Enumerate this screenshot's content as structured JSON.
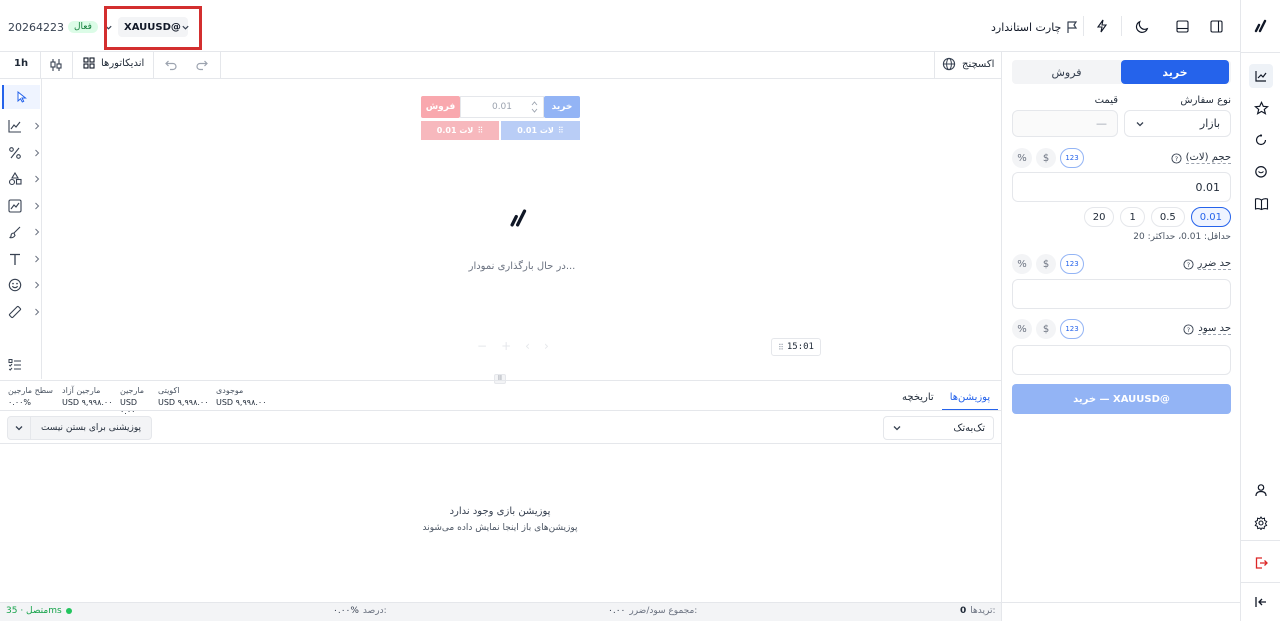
{
  "header": {
    "account_id": "20264223",
    "account_status": "فعال",
    "symbol": "XAUUSD@",
    "chart_type": "چارت استاندارد"
  },
  "chart_toolbar": {
    "exchange": "اکسچنج",
    "indicators": "اندیکاتورها",
    "timeframe": "1h"
  },
  "chart": {
    "loading_text": "در حال بارگذاری نمودار...",
    "time_label": "15:01",
    "trade_widget": {
      "buy_label": "خرید",
      "sell_label": "فروش",
      "lot_value": "0.01",
      "buy_lot_line": "لات 0.01",
      "sell_lot_line": "لات 0.01"
    }
  },
  "order_panel": {
    "buy_tab": "خرید",
    "sell_tab": "فروش",
    "order_type_label": "نوع سفارش",
    "order_type_value": "بازار",
    "price_label": "قیمت",
    "price_placeholder": "—",
    "volume_label": "حجم (لات)",
    "volume_value": "0.01",
    "quick_lots": [
      "0.01",
      "0.5",
      "1",
      "20"
    ],
    "limits_text": "حداقل: 0.01، حداکثر: 20",
    "stop_loss_label": "حد ضرر",
    "take_profit_label": "حد سود",
    "mode_chips": [
      "123",
      "$",
      "%"
    ],
    "submit_label": "خرید — XAUUSD@"
  },
  "bottom_panel": {
    "tabs": [
      "پوزیشن‌ها",
      "تاریخچه"
    ],
    "stats": [
      {
        "label": "موجودی",
        "value": "USD ۹,۹۹۸.۰۰"
      },
      {
        "label": "اکویتی",
        "value": "USD ۹,۹۹۸.۰۰"
      },
      {
        "label": "مارجین",
        "value": "USD ۰.۰۰"
      },
      {
        "label": "مارجین آزاد",
        "value": "USD ۹,۹۹۸.۰۰"
      },
      {
        "label": "سطح مارجین",
        "value": "۰.۰۰%"
      }
    ],
    "filter_value": "تک‌به‌تک",
    "close_positions": "پوزیشنی برای بستن نیست",
    "empty_title": "پوزیشن بازی وجود ندارد",
    "empty_subtitle": "پوزیشن‌های باز اینجا نمایش داده می‌شوند"
  },
  "status_bar": {
    "trades_label": "تریدها:",
    "trades_value": "0",
    "pnl_label": "مجموع سود/ضرر:",
    "pnl_value": "۰.۰۰",
    "percent_label": "درصد:",
    "percent_value": "۰.۰۰%",
    "connection": "متصل · 35ms"
  },
  "colors": {
    "primary": "#2563eb",
    "primary_light": "#93b4f5",
    "sell_light": "#f9a8ae",
    "success": "#22c55e",
    "highlight": "#dc2626"
  }
}
